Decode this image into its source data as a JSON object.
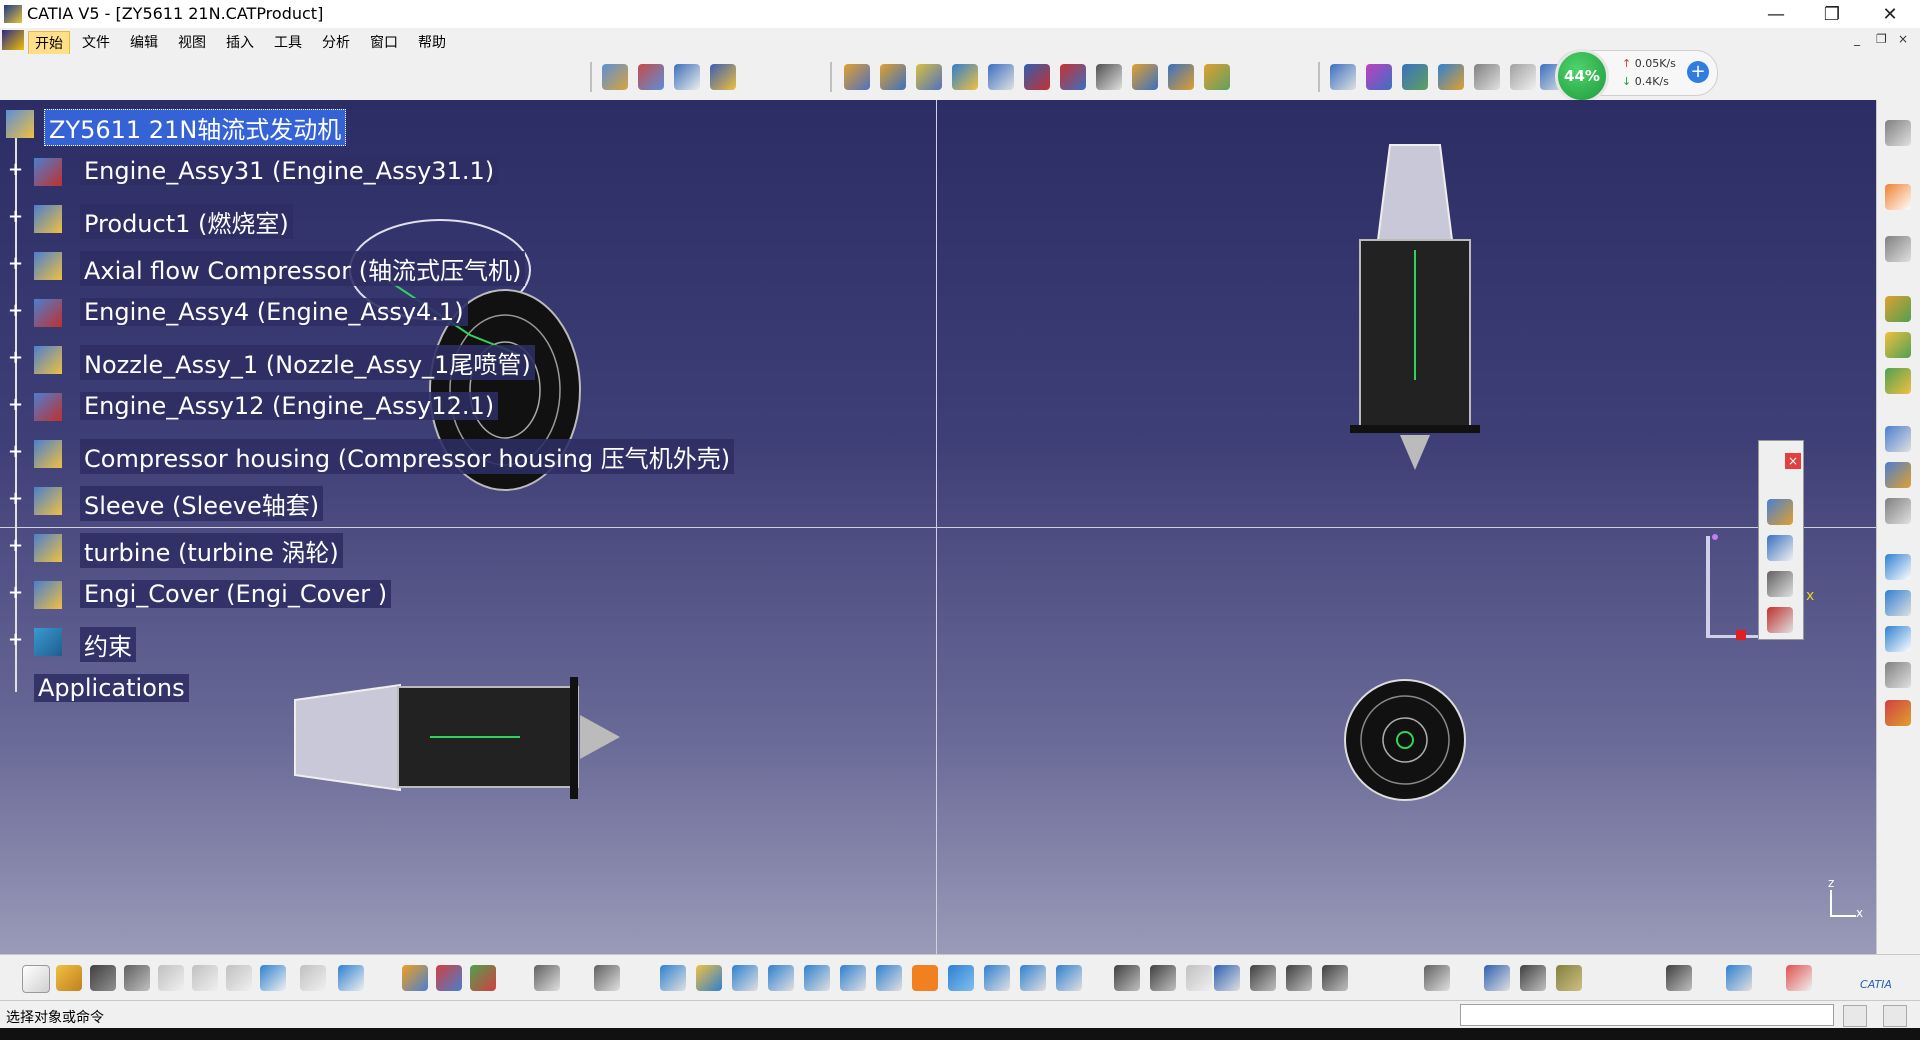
{
  "window": {
    "title": "CATIA V5 - [ZY5611 21N.CATProduct]",
    "minimize": "—",
    "restore": "❐",
    "close": "✕"
  },
  "menu": {
    "items": [
      "开始",
      "文件",
      "编辑",
      "视图",
      "插入",
      "工具",
      "分析",
      "窗口",
      "帮助"
    ],
    "active_index": 0,
    "mdi_minimize": "_",
    "mdi_restore": "❐",
    "mdi_close": "×"
  },
  "netmon": {
    "percent": "44%",
    "up": "0.05K/s",
    "down": "0.4K/s",
    "up_arrow": "↑",
    "down_arrow": "↓",
    "plus": "+"
  },
  "tree": {
    "root": "ZY5611 21N轴流式发动机",
    "items": [
      "Engine_Assy31 (Engine_Assy31.1)",
      "Product1 (燃烧室)",
      "Axial flow Compressor (轴流式压气机)",
      "Engine_Assy4 (Engine_Assy4.1)",
      "Nozzle_Assy_1 (Nozzle_Assy_1尾喷管)",
      "Engine_Assy12 (Engine_Assy12.1)",
      "Compressor housing (Compressor housing 压气机外壳)",
      "Sleeve (Sleeve轴套)",
      "turbine (turbine 涡轮)",
      "Engi_Cover (Engi_Cover )",
      "约束"
    ],
    "applications": "Applications",
    "expander": "+"
  },
  "float_panel": {
    "close": "×"
  },
  "axis": {
    "x": "x",
    "z": "z",
    "compass_x": "x"
  },
  "status": {
    "prompt": "选择对象或命令"
  },
  "brand": {
    "logo_text": "CATIA"
  },
  "colors": {
    "viewport_top": "#2d2d66",
    "viewport_bottom": "#9a9ab8",
    "tree_selected": "#3563d6",
    "menu_active": "#ffe089",
    "netmon_green": "#1f9b3c"
  }
}
